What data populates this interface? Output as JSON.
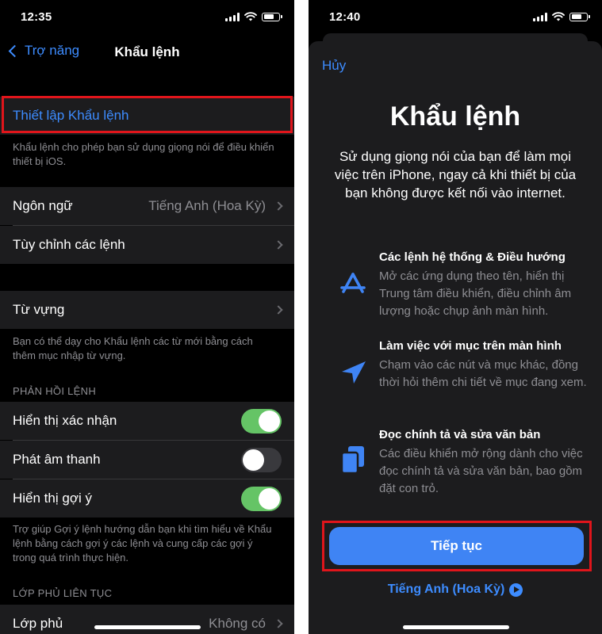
{
  "left": {
    "status_time": "12:35",
    "nav_back": "Trợ năng",
    "nav_title": "Khẩu lệnh",
    "setup_label": "Thiết lập Khẩu lệnh",
    "setup_footnote": "Khẩu lệnh cho phép bạn sử dụng giọng nói để điều khiển thiết bị iOS.",
    "language_label": "Ngôn ngữ",
    "language_value": "Tiếng Anh (Hoa Kỳ)",
    "customize_label": "Tùy chỉnh các lệnh",
    "vocab_label": "Từ vựng",
    "vocab_footnote": "Bạn có thể dạy cho Khẩu lệnh các từ mới bằng cách thêm mục nhập từ vựng.",
    "feedback_header": "PHẢN HỒI LỆNH",
    "toggles": [
      {
        "label": "Hiển thị xác nhận",
        "on": true
      },
      {
        "label": "Phát âm thanh",
        "on": false
      },
      {
        "label": "Hiển thị gợi ý",
        "on": true
      }
    ],
    "hints_footnote": "Trợ giúp Gợi ý lệnh hướng dẫn bạn khi tìm hiểu về Khẩu lệnh bằng cách gợi ý các lệnh và cung cấp các gợi ý trong quá trình thực hiện.",
    "overlay_header": "LỚP PHỦ LIÊN TỤC",
    "overlay_label": "Lớp phủ",
    "overlay_value": "Không có"
  },
  "right": {
    "status_time": "12:40",
    "cancel": "Hủy",
    "title": "Khẩu lệnh",
    "intro": "Sử dụng giọng nói của bạn để làm mọi việc trên iPhone, ngay cả khi thiết bị của bạn không được kết nối vào internet.",
    "features": [
      {
        "icon": "app-store-icon",
        "title": "Các lệnh hệ thống & Điều hướng",
        "desc": "Mở các ứng dụng theo tên, hiển thị Trung tâm điều khiển, điều chỉnh âm lượng hoặc chụp ảnh màn hình."
      },
      {
        "icon": "location-arrow-icon",
        "title": "Làm việc với mục trên màn hình",
        "desc": "Chạm vào các nút và mục khác, đồng thời hỏi thêm chi tiết về mục đang xem."
      },
      {
        "icon": "documents-icon",
        "title": "Đọc chính tả và sửa văn bản",
        "desc": "Các điều khiển mở rộng dành cho việc đọc chính tả và sửa văn bản, bao gồm đặt con trỏ."
      }
    ],
    "continue": "Tiếp tục",
    "language_link": "Tiếng Anh (Hoa Kỳ)"
  },
  "colors": {
    "accent": "#3d8cff",
    "highlight_box": "#e0151b",
    "toggle_on": "#65c466",
    "button": "#3f84f4"
  }
}
